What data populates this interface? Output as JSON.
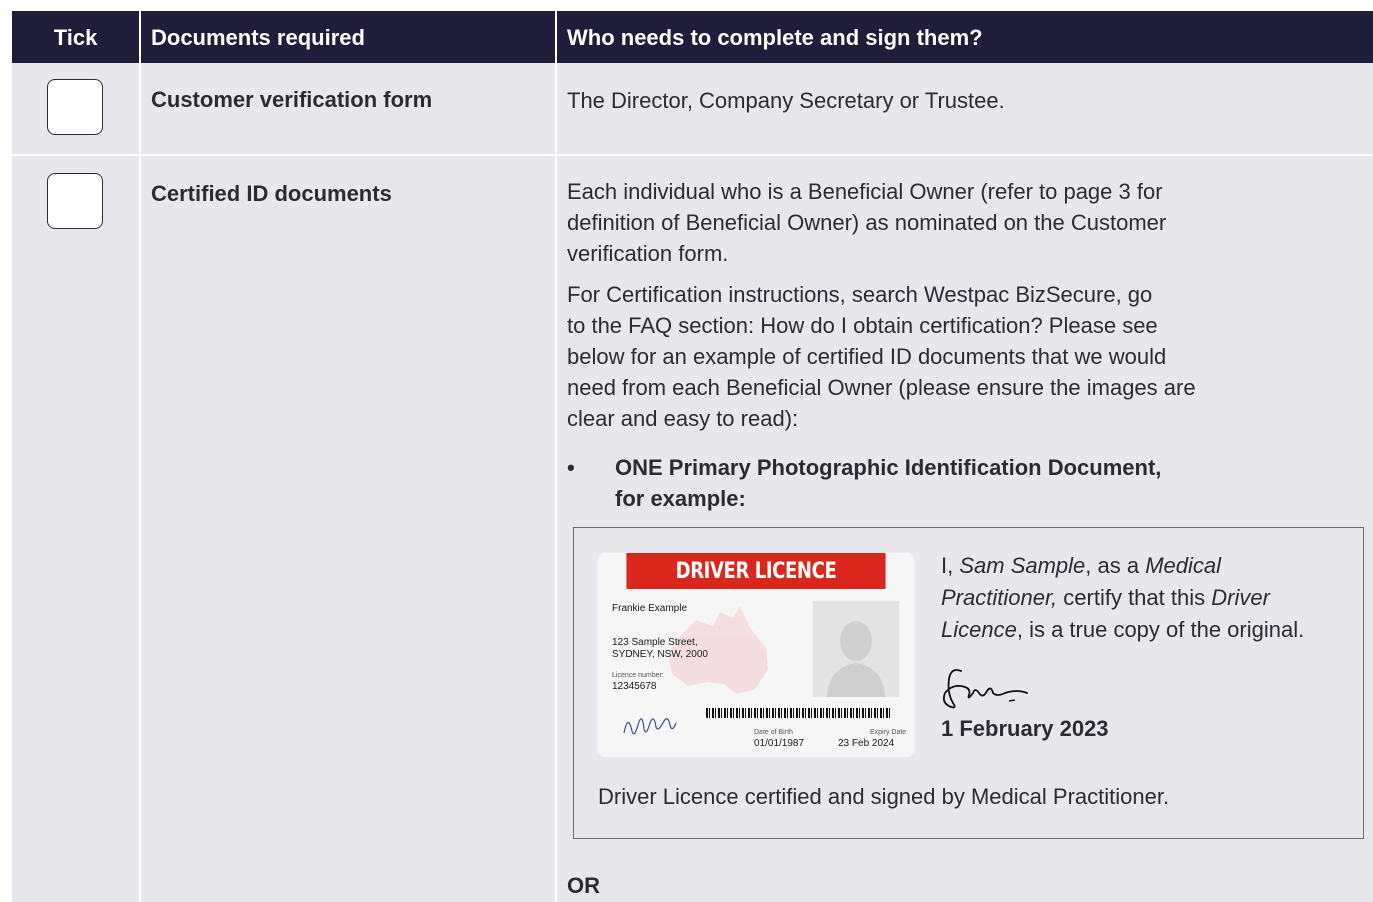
{
  "header": {
    "col_tick": "Tick",
    "col_documents": "Documents required",
    "col_who": "Who needs to complete and sign them?"
  },
  "rows": [
    {
      "document": "Customer verification form",
      "who": "The Director, Company Secretary or Trustee."
    },
    {
      "document": "Certified ID documents",
      "who_para1_lines": [
        "Each individual who is a Beneficial Owner (refer to page 3 for",
        "definition of Beneficial Owner) as nominated on the Customer",
        "verification form."
      ],
      "who_para2_lines": [
        "For Certification instructions, search Westpac BizSecure, go",
        "to the FAQ section: How do I obtain certification? Please see",
        "below for an example of certified ID documents that we would",
        "need from each Beneficial Owner (please ensure the images are",
        "clear and easy to read):"
      ],
      "bullet_marker": "•",
      "bullet_lines": [
        "ONE Primary Photographic Identification Document,",
        "for example:"
      ]
    }
  ],
  "example": {
    "card": {
      "title": "DRIVER LICENCE",
      "name": "Frankie Example",
      "address_line1": "123 Sample Street,",
      "address_line2": "SYDNEY, NSW, 2000",
      "licence_label": "Licence number:",
      "licence_number": "12345678",
      "dob_label": "Date of Birth",
      "dob_value": "01/01/1987",
      "expiry_label": "Expiry Date",
      "expiry_value": "23 Feb 2024",
      "header_color": "#d9271d"
    },
    "cert": {
      "i_prefix": "I, ",
      "certifier": "Sam Sample",
      "as_a": ", as a ",
      "role_line1": "Medical",
      "role_line2": "Practitioner,",
      "certify": " certify that this ",
      "doc_line2": "Driver",
      "doc_line3": "Licence",
      "tail": ", is a true copy of the original.",
      "date": "1 February 2023"
    },
    "caption": "Driver Licence certified and signed by Medical Practitioner."
  },
  "or_text": "OR",
  "colors": {
    "header_bg": "#1f1d3a",
    "row_bg": "#e8e8ec"
  },
  "icons": [
    "checkbox-icon",
    "checkbox-icon",
    "signature-icon",
    "signature-icon",
    "australia-map-icon",
    "person-silhouette-icon",
    "barcode-icon"
  ]
}
